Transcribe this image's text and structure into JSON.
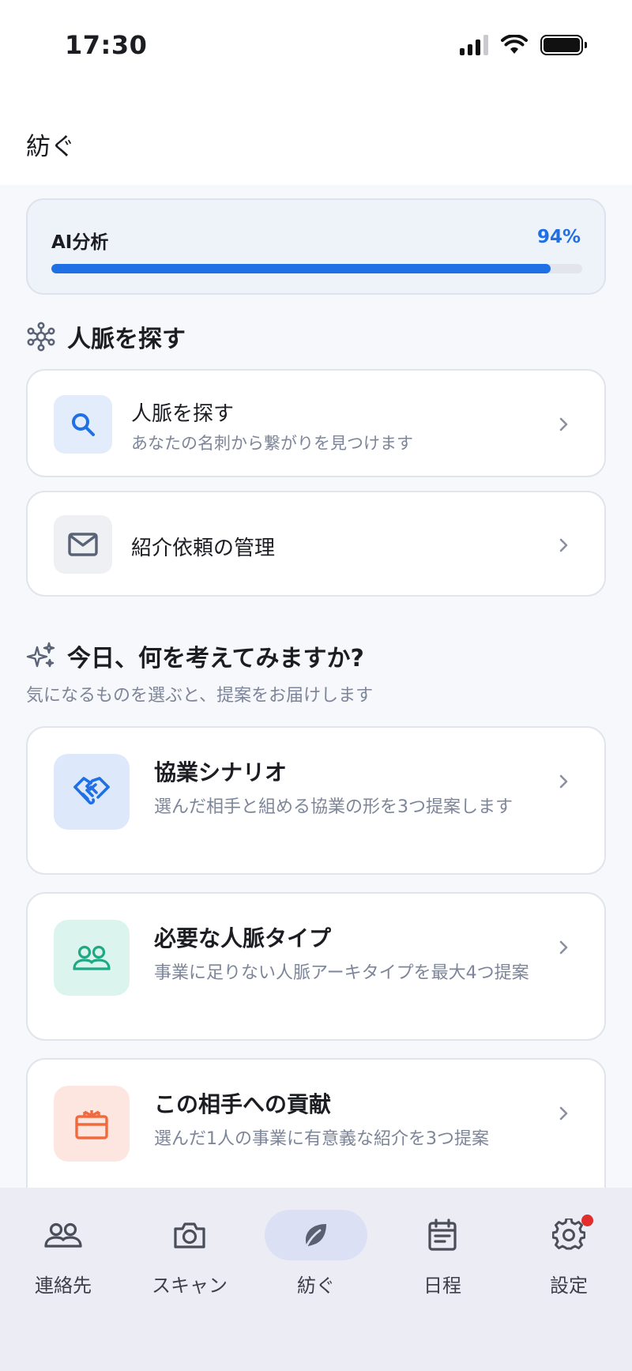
{
  "status_bar": {
    "time": "17:30"
  },
  "header": {
    "title": "紡ぐ"
  },
  "ai_analysis": {
    "label": "AI分析",
    "percent_text": "94%",
    "progress": 0.94
  },
  "network_section": {
    "title": "人脈を探す",
    "items": [
      {
        "title": "人脈を探す",
        "description": "あなたの名刺から繋がりを見つけます",
        "icon": "search-icon"
      },
      {
        "title": "紹介依頼の管理",
        "icon": "mail-icon"
      }
    ]
  },
  "ideas_section": {
    "title": "今日、何を考えてみますか?",
    "subtitle": "気になるものを選ぶと、提案をお届けします",
    "items": [
      {
        "title": "協業シナリオ",
        "description": "選んだ相手と組める協業の形を3つ提案します",
        "icon": "handshake-icon"
      },
      {
        "title": "必要な人脈タイプ",
        "description": "事業に足りない人脈アーキタイプを最大4つ提案",
        "icon": "people-icon"
      },
      {
        "title": "この相手への貢献",
        "description": "選んだ1人の事業に有意義な紹介を3つ提案",
        "icon": "gift-icon"
      }
    ]
  },
  "bottom_nav": {
    "items": [
      {
        "label": "連絡先",
        "icon": "contacts-icon"
      },
      {
        "label": "スキャン",
        "icon": "camera-icon"
      },
      {
        "label": "紡ぐ",
        "icon": "leaf-icon",
        "active": true
      },
      {
        "label": "日程",
        "icon": "calendar-icon"
      },
      {
        "label": "設定",
        "icon": "gear-icon",
        "badge": true
      }
    ]
  },
  "colors": {
    "accent": "#1f6fe5",
    "handshake_bg": "#dde9fb",
    "people_bg": "#dcf4ee",
    "gift_bg": "#fde6df",
    "badge": "#e22d2d"
  }
}
